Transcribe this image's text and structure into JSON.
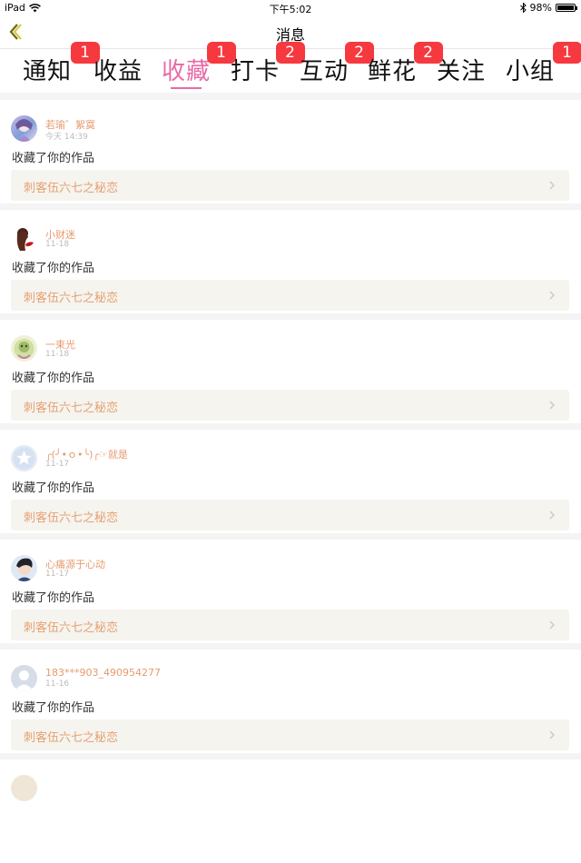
{
  "status_bar": {
    "device": "iPad",
    "time": "下午5:02",
    "battery": "98%",
    "battery_level": 0.98
  },
  "header": {
    "title": "消息"
  },
  "tabs": [
    {
      "label": "通知",
      "badge": "1"
    },
    {
      "label": "收益",
      "badge": ""
    },
    {
      "label": "收藏",
      "badge": "1",
      "active": true
    },
    {
      "label": "打卡",
      "badge": "2"
    },
    {
      "label": "互动",
      "badge": "2"
    },
    {
      "label": "鲜花",
      "badge": "2"
    },
    {
      "label": "关注",
      "badge": ""
    },
    {
      "label": "小组",
      "badge": "1"
    }
  ],
  "notifications": [
    {
      "user": "若瑜゛絮寞",
      "time": "今天 14:39",
      "action": "收藏了你的作品",
      "work": "刺客伍六七之秘恋",
      "avatar": "anime-avatar"
    },
    {
      "user": "小财迷",
      "time": "11-18",
      "action": "收藏了你的作品",
      "work": "刺客伍六七之秘恋",
      "avatar": "figure-avatar"
    },
    {
      "user": "一束光",
      "time": "11-18",
      "action": "收藏了你的作品",
      "work": "刺客伍六七之秘恋",
      "avatar": "flower-avatar"
    },
    {
      "user": "╭(╯•ｏ•╰)╭☞就是",
      "time": "11-17",
      "action": "收藏了你的作品",
      "work": "刺客伍六七之秘恋",
      "avatar": "star-avatar"
    },
    {
      "user": "心痛源于心动",
      "time": "11-17",
      "action": "收藏了你的作品",
      "work": "刺客伍六七之秘恋",
      "avatar": "boy-avatar"
    },
    {
      "user": "183***903_490954277",
      "time": "11-16",
      "action": "收藏了你的作品",
      "work": "刺客伍六七之秘恋",
      "avatar": "default-avatar"
    }
  ],
  "colors": {
    "accent": "#e86aa6",
    "badge": "#f6383f",
    "username": "#e69a6f",
    "work_title": "#e6a073"
  }
}
